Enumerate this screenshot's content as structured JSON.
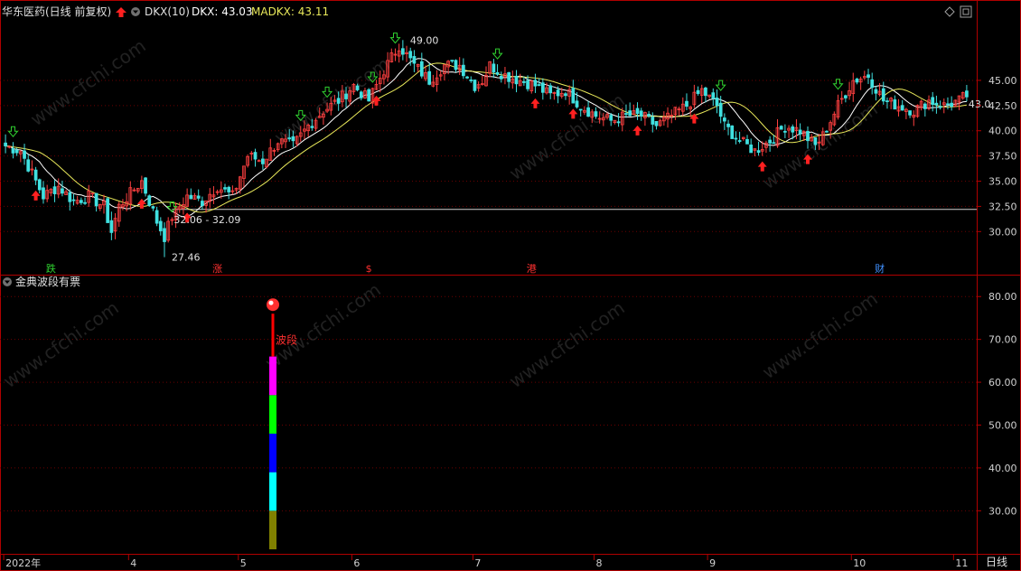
{
  "header": {
    "stock_title": "华东医药(日线 前复权)",
    "indicator_name": "DKX(10)",
    "dkx_readout": "DKX: 43.03",
    "madkx_readout": "MADKX: 43.11"
  },
  "indicator_panel": {
    "title": "金典波段有票",
    "band_label": "波段"
  },
  "period_label": "日线",
  "colors": {
    "background": "#000000",
    "frame": "#b00000",
    "up_candle": "#ff4040",
    "down_candle": "#40e0e0",
    "dkx_line": "#ffffff",
    "madkx_line": "#e8e85a",
    "grid": "#6a0000",
    "up_arrow": "#ff2020",
    "down_arrow": "#30d030"
  },
  "icons": [
    "collapse-icon",
    "red-up-arrow-icon",
    "diamond-icon",
    "window-icon",
    "ball-icon"
  ],
  "chart_data": [
    {
      "type": "candlestick",
      "title": "华东医药(日线 前复权)",
      "ylim": [
        26.8,
        51.0
      ],
      "y_ticks": [
        30.0,
        32.5,
        35.0,
        37.5,
        40.0,
        42.5,
        45.0
      ],
      "y_tick_labels": [
        "30.00",
        "32.50",
        "35.00",
        "37.50",
        "40.00",
        "42.50",
        "45.00"
      ],
      "x_ticks": [
        "2022年",
        "4",
        "5",
        "6",
        "7",
        "8",
        "9",
        "10",
        "11"
      ],
      "support_line": 32.2,
      "annotations": [
        {
          "text": "49.00",
          "value": 49.0
        },
        {
          "text": "32.06 - 32.09",
          "value": 32.07
        },
        {
          "text": "27.46",
          "value": 27.46
        },
        {
          "text": "43.0",
          "value": 43.03
        }
      ],
      "event_markers": [
        {
          "text": "跌",
          "color": "#30d030"
        },
        {
          "text": "涨",
          "color": "#ff3030"
        },
        {
          "text": "$",
          "color": "#ff3030"
        },
        {
          "text": "港",
          "color": "#ff3030"
        },
        {
          "text": "财",
          "color": "#4090ff"
        }
      ],
      "anchors": [
        [
          0,
          38.5
        ],
        [
          4,
          38.0
        ],
        [
          6,
          36.5
        ],
        [
          10,
          33.5
        ],
        [
          14,
          34.5
        ],
        [
          18,
          33.0
        ],
        [
          22,
          33.5
        ],
        [
          26,
          32.5
        ],
        [
          28,
          30.0
        ],
        [
          30,
          32.5
        ],
        [
          34,
          34.2
        ],
        [
          36,
          35.0
        ],
        [
          38,
          33.0
        ],
        [
          40,
          31.0
        ],
        [
          42,
          29.5
        ],
        [
          44,
          31.5
        ],
        [
          48,
          33.5
        ],
        [
          52,
          33.0
        ],
        [
          56,
          34.5
        ],
        [
          60,
          33.5
        ],
        [
          64,
          37.5
        ],
        [
          68,
          37.0
        ],
        [
          72,
          39.0
        ],
        [
          76,
          38.5
        ],
        [
          80,
          40.5
        ],
        [
          84,
          42.0
        ],
        [
          88,
          43.0
        ],
        [
          92,
          44.5
        ],
        [
          96,
          43.0
        ],
        [
          100,
          46.0
        ],
        [
          104,
          48.5
        ],
        [
          106,
          47.5
        ],
        [
          108,
          46.5
        ],
        [
          112,
          45.0
        ],
        [
          116,
          46.5
        ],
        [
          120,
          46.5
        ],
        [
          124,
          44.5
        ],
        [
          126,
          45.0
        ],
        [
          128,
          46.5
        ],
        [
          132,
          45.5
        ],
        [
          136,
          45.0
        ],
        [
          140,
          44.5
        ],
        [
          144,
          43.5
        ],
        [
          148,
          44.0
        ],
        [
          152,
          42.5
        ],
        [
          156,
          41.5
        ],
        [
          160,
          41.0
        ],
        [
          164,
          41.5
        ],
        [
          168,
          41.5
        ],
        [
          172,
          40.5
        ],
        [
          176,
          41.5
        ],
        [
          180,
          42.5
        ],
        [
          184,
          44.0
        ],
        [
          188,
          42.5
        ],
        [
          190,
          40.5
        ],
        [
          194,
          39.0
        ],
        [
          198,
          38.0
        ],
        [
          202,
          39.0
        ],
        [
          206,
          40.5
        ],
        [
          210,
          40.0
        ],
        [
          214,
          38.5
        ],
        [
          216,
          39.5
        ],
        [
          220,
          42.5
        ],
        [
          224,
          45.0
        ],
        [
          228,
          45.5
        ],
        [
          232,
          43.0
        ],
        [
          236,
          42.5
        ],
        [
          240,
          42.0
        ],
        [
          244,
          43.0
        ],
        [
          248,
          42.5
        ],
        [
          252,
          43.0
        ],
        [
          254,
          43.5
        ]
      ],
      "up_arrow_bars": [
        8,
        36,
        48,
        98,
        140,
        150,
        167,
        182,
        200,
        212
      ],
      "down_arrow_bars": [
        2,
        44,
        78,
        85,
        97,
        103,
        130,
        189,
        220
      ]
    },
    {
      "type": "bar",
      "title": "金典波段有票",
      "ylim": [
        21,
        83
      ],
      "y_ticks": [
        30,
        40,
        50,
        60,
        70,
        80
      ],
      "y_tick_labels": [
        "30.00",
        "40.00",
        "50.00",
        "60.00",
        "70.00",
        "80.00"
      ],
      "stacked_segments": [
        {
          "from": 21,
          "to": 30,
          "color": "#808000"
        },
        {
          "from": 30,
          "to": 39,
          "color": "#00ffff"
        },
        {
          "from": 39,
          "to": 48,
          "color": "#0000ff"
        },
        {
          "from": 48,
          "to": 57,
          "color": "#00ff00"
        },
        {
          "from": 57,
          "to": 66,
          "color": "#ff00ff"
        },
        {
          "from": 66,
          "to": 76,
          "color": "#ff0000"
        }
      ]
    }
  ]
}
